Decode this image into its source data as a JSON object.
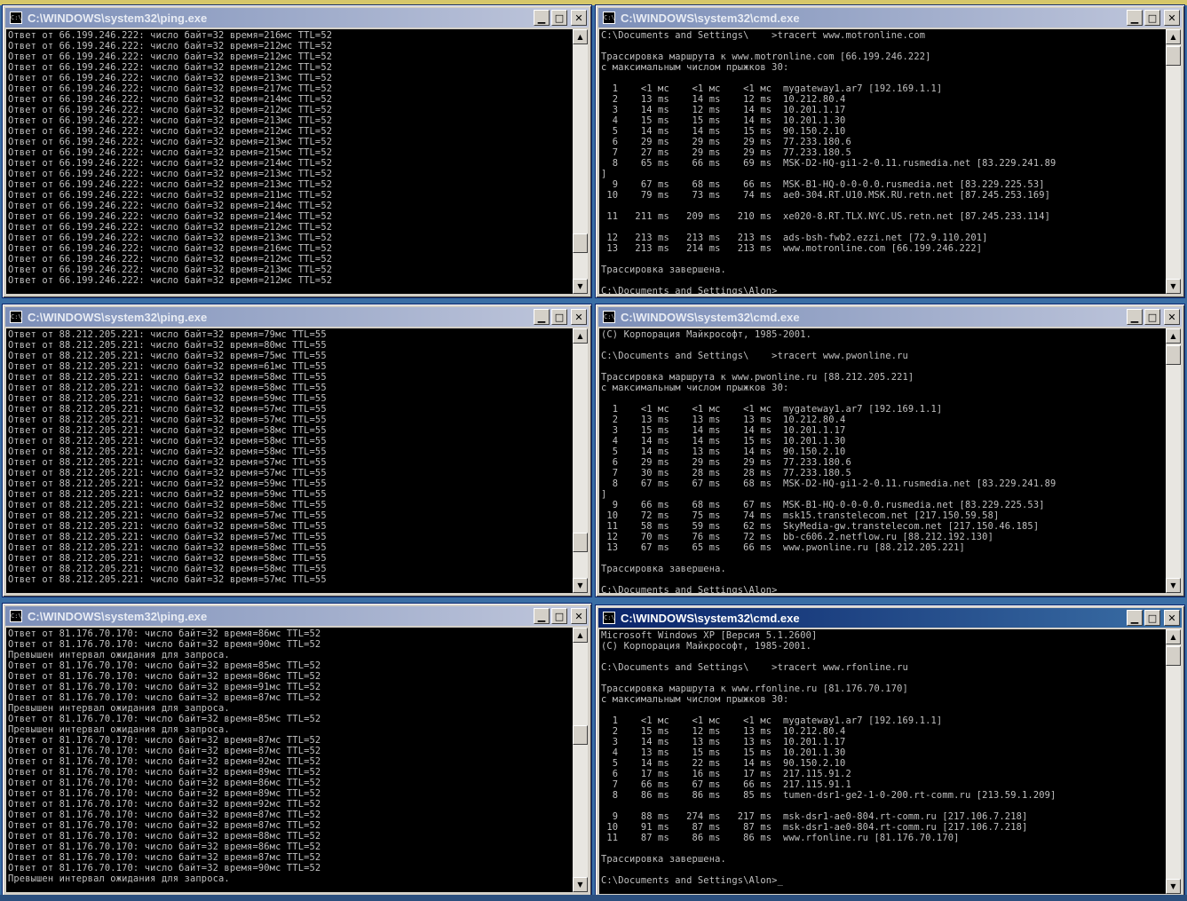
{
  "icon_label": "C:\\",
  "windows": [
    {
      "title": "C:\\WINDOWS\\system32\\ping.exe",
      "lines": [
        "Ответ от 66.199.246.222: число байт=32 время=216мс TTL=52",
        "Ответ от 66.199.246.222: число байт=32 время=212мс TTL=52",
        "Ответ от 66.199.246.222: число байт=32 время=212мс TTL=52",
        "Ответ от 66.199.246.222: число байт=32 время=212мс TTL=52",
        "Ответ от 66.199.246.222: число байт=32 время=213мс TTL=52",
        "Ответ от 66.199.246.222: число байт=32 время=217мс TTL=52",
        "Ответ от 66.199.246.222: число байт=32 время=214мс TTL=52",
        "Ответ от 66.199.246.222: число байт=32 время=212мс TTL=52",
        "Ответ от 66.199.246.222: число байт=32 время=213мс TTL=52",
        "Ответ от 66.199.246.222: число байт=32 время=212мс TTL=52",
        "Ответ от 66.199.246.222: число байт=32 время=213мс TTL=52",
        "Ответ от 66.199.246.222: число байт=32 время=215мс TTL=52",
        "Ответ от 66.199.246.222: число байт=32 время=214мс TTL=52",
        "Ответ от 66.199.246.222: число байт=32 время=213мс TTL=52",
        "Ответ от 66.199.246.222: число байт=32 время=213мс TTL=52",
        "Ответ от 66.199.246.222: число байт=32 время=211мс TTL=52",
        "Ответ от 66.199.246.222: число байт=32 время=214мс TTL=52",
        "Ответ от 66.199.246.222: число байт=32 время=214мс TTL=52",
        "Ответ от 66.199.246.222: число байт=32 время=212мс TTL=52",
        "Ответ от 66.199.246.222: число байт=32 время=213мс TTL=52",
        "Ответ от 66.199.246.222: число байт=32 время=216мс TTL=52",
        "Ответ от 66.199.246.222: число байт=32 время=212мс TTL=52",
        "Ответ от 66.199.246.222: число байт=32 время=213мс TTL=52",
        "Ответ от 66.199.246.222: число байт=32 время=212мс TTL=52"
      ]
    },
    {
      "title": "C:\\WINDOWS\\system32\\cmd.exe",
      "lines": [
        "C:\\Documents and Settings\\    >tracert www.motronline.com",
        "",
        "Трассировка маршрута к www.motronline.com [66.199.246.222]",
        "с максимальным числом прыжков 30:",
        "",
        "  1    <1 мс    <1 мс    <1 мс  mygateway1.ar7 [192.169.1.1]",
        "  2    13 ms    14 ms    12 ms  10.212.80.4",
        "  3    14 ms    12 ms    14 ms  10.201.1.17",
        "  4    15 ms    15 ms    14 ms  10.201.1.30",
        "  5    14 ms    14 ms    15 ms  90.150.2.10",
        "  6    29 ms    29 ms    29 ms  77.233.180.6",
        "  7    27 ms    29 ms    29 ms  77.233.180.5",
        "  8    65 ms    66 ms    69 ms  MSK-D2-HQ-gi1-2-0.11.rusmedia.net [83.229.241.89",
        "]",
        "  9    67 ms    68 ms    66 ms  MSK-B1-HQ-0-0-0.0.rusmedia.net [83.229.225.53]",
        " 10    79 ms    73 ms    74 ms  ae0-304.RT.U10.MSK.RU.retn.net [87.245.253.169]",
        "",
        " 11   211 ms   209 ms   210 ms  xe020-8.RT.TLX.NYC.US.retn.net [87.245.233.114]",
        "",
        " 12   213 ms   213 ms   213 ms  ads-bsh-fwb2.ezzi.net [72.9.110.201]",
        " 13   213 ms   214 ms   213 ms  www.motronline.com [66.199.246.222]",
        "",
        "Трассировка завершена.",
        "",
        "C:\\Documents and Settings\\Alon>"
      ]
    },
    {
      "title": "C:\\WINDOWS\\system32\\ping.exe",
      "lines": [
        "Ответ от 88.212.205.221: число байт=32 время=79мс TTL=55",
        "Ответ от 88.212.205.221: число байт=32 время=80мс TTL=55",
        "Ответ от 88.212.205.221: число байт=32 время=75мс TTL=55",
        "Ответ от 88.212.205.221: число байт=32 время=61мс TTL=55",
        "Ответ от 88.212.205.221: число байт=32 время=58мс TTL=55",
        "Ответ от 88.212.205.221: число байт=32 время=58мс TTL=55",
        "Ответ от 88.212.205.221: число байт=32 время=59мс TTL=55",
        "Ответ от 88.212.205.221: число байт=32 время=57мс TTL=55",
        "Ответ от 88.212.205.221: число байт=32 время=57мс TTL=55",
        "Ответ от 88.212.205.221: число байт=32 время=58мс TTL=55",
        "Ответ от 88.212.205.221: число байт=32 время=58мс TTL=55",
        "Ответ от 88.212.205.221: число байт=32 время=58мс TTL=55",
        "Ответ от 88.212.205.221: число байт=32 время=57мс TTL=55",
        "Ответ от 88.212.205.221: число байт=32 время=57мс TTL=55",
        "Ответ от 88.212.205.221: число байт=32 время=59мс TTL=55",
        "Ответ от 88.212.205.221: число байт=32 время=59мс TTL=55",
        "Ответ от 88.212.205.221: число байт=32 время=58мс TTL=55",
        "Ответ от 88.212.205.221: число байт=32 время=57мс TTL=55",
        "Ответ от 88.212.205.221: число байт=32 время=58мс TTL=55",
        "Ответ от 88.212.205.221: число байт=32 время=57мс TTL=55",
        "Ответ от 88.212.205.221: число байт=32 время=58мс TTL=55",
        "Ответ от 88.212.205.221: число байт=32 время=58мс TTL=55",
        "Ответ от 88.212.205.221: число байт=32 время=58мс TTL=55",
        "Ответ от 88.212.205.221: число байт=32 время=57мс TTL=55"
      ]
    },
    {
      "title": "C:\\WINDOWS\\system32\\cmd.exe",
      "lines": [
        "(C) Корпорация Майкрософт, 1985-2001.",
        "",
        "C:\\Documents and Settings\\    >tracert www.pwonline.ru",
        "",
        "Трассировка маршрута к www.pwonline.ru [88.212.205.221]",
        "с максимальным числом прыжков 30:",
        "",
        "  1    <1 мс    <1 мс    <1 мс  mygateway1.ar7 [192.169.1.1]",
        "  2    13 ms    13 ms    13 ms  10.212.80.4",
        "  3    15 ms    14 ms    14 ms  10.201.1.17",
        "  4    14 ms    14 ms    15 ms  10.201.1.30",
        "  5    14 ms    13 ms    14 ms  90.150.2.10",
        "  6    29 ms    29 ms    29 ms  77.233.180.6",
        "  7    30 ms    28 ms    28 ms  77.233.180.5",
        "  8    67 ms    67 ms    68 ms  MSK-D2-HQ-gi1-2-0.11.rusmedia.net [83.229.241.89",
        "]",
        "  9    66 ms    68 ms    67 ms  MSK-B1-HQ-0-0-0.0.rusmedia.net [83.229.225.53]",
        " 10    72 ms    75 ms    74 ms  msk15.transtelecom.net [217.150.59.58]",
        " 11    58 ms    59 ms    62 ms  SkyMedia-gw.transtelecom.net [217.150.46.185]",
        " 12    70 ms    76 ms    72 ms  bb-c606.2.netflow.ru [88.212.192.130]",
        " 13    67 ms    65 ms    66 ms  www.pwonline.ru [88.212.205.221]",
        "",
        "Трассировка завершена.",
        "",
        "C:\\Documents and Settings\\Alon>"
      ]
    },
    {
      "title": "C:\\WINDOWS\\system32\\ping.exe",
      "lines": [
        "Ответ от 81.176.70.170: число байт=32 время=86мс TTL=52",
        "Ответ от 81.176.70.170: число байт=32 время=90мс TTL=52",
        "Превышен интервал ожидания для запроса.",
        "Ответ от 81.176.70.170: число байт=32 время=85мс TTL=52",
        "Ответ от 81.176.70.170: число байт=32 время=86мс TTL=52",
        "Ответ от 81.176.70.170: число байт=32 время=91мс TTL=52",
        "Ответ от 81.176.70.170: число байт=32 время=87мс TTL=52",
        "Превышен интервал ожидания для запроса.",
        "Ответ от 81.176.70.170: число байт=32 время=85мс TTL=52",
        "Превышен интервал ожидания для запроса.",
        "Ответ от 81.176.70.170: число байт=32 время=87мс TTL=52",
        "Ответ от 81.176.70.170: число байт=32 время=87мс TTL=52",
        "Ответ от 81.176.70.170: число байт=32 время=92мс TTL=52",
        "Ответ от 81.176.70.170: число байт=32 время=89мс TTL=52",
        "Ответ от 81.176.70.170: число байт=32 время=86мс TTL=52",
        "Ответ от 81.176.70.170: число байт=32 время=89мс TTL=52",
        "Ответ от 81.176.70.170: число байт=32 время=92мс TTL=52",
        "Ответ от 81.176.70.170: число байт=32 время=87мс TTL=52",
        "Ответ от 81.176.70.170: число байт=32 время=87мс TTL=52",
        "Ответ от 81.176.70.170: число байт=32 время=88мс TTL=52",
        "Ответ от 81.176.70.170: число байт=32 время=86мс TTL=52",
        "Ответ от 81.176.70.170: число байт=32 время=87мс TTL=52",
        "Ответ от 81.176.70.170: число байт=32 время=90мс TTL=52",
        "Превышен интервал ожидания для запроса."
      ]
    },
    {
      "title": "C:\\WINDOWS\\system32\\cmd.exe",
      "active": true,
      "lines": [
        "Microsoft Windows XP [Версия 5.1.2600]",
        "(C) Корпорация Майкрософт, 1985-2001.",
        "",
        "C:\\Documents and Settings\\    >tracert www.rfonline.ru",
        "",
        "Трассировка маршрута к www.rfonline.ru [81.176.70.170]",
        "с максимальным числом прыжков 30:",
        "",
        "  1    <1 мс    <1 мс    <1 мс  mygateway1.ar7 [192.169.1.1]",
        "  2    15 ms    12 ms    13 ms  10.212.80.4",
        "  3    14 ms    13 ms    13 ms  10.201.1.17",
        "  4    13 ms    15 ms    15 ms  10.201.1.30",
        "  5    14 ms    22 ms    14 ms  90.150.2.10",
        "  6    17 ms    16 ms    17 ms  217.115.91.2",
        "  7    66 ms    67 ms    66 ms  217.115.91.1",
        "  8    86 ms    86 ms    85 ms  tumen-dsr1-ge2-1-0-200.rt-comm.ru [213.59.1.209]",
        "",
        "  9    88 ms   274 ms   217 ms  msk-dsr1-ae0-804.rt-comm.ru [217.106.7.218]",
        " 10    91 ms    87 ms    87 ms  msk-dsr1-ae0-804.rt-comm.ru [217.106.7.218]",
        " 11    87 ms    86 ms    86 ms  www.rfonline.ru [81.176.70.170]",
        "",
        "Трассировка завершена.",
        "",
        "C:\\Documents and Settings\\Alon>"
      ],
      "cursor": "_"
    }
  ],
  "buttons": {
    "minimize": "▁",
    "maximize": "□",
    "close": "✕"
  },
  "scroll_arrows": {
    "up": "▲",
    "down": "▼"
  }
}
